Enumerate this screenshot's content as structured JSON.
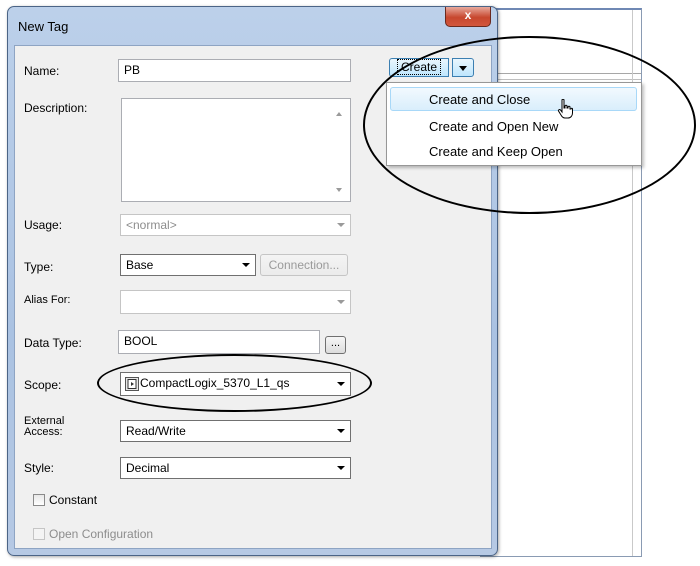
{
  "dialog": {
    "title": "New Tag",
    "close_label": "x"
  },
  "form": {
    "name_label": "Name:",
    "name_value": "PB",
    "description_label": "Description:",
    "description_value": "",
    "usage_label": "Usage:",
    "usage_value": "<normal>",
    "type_label": "Type:",
    "type_value": "Base",
    "connection_label": "Connection...",
    "alias_label": "Alias For:",
    "alias_value": "",
    "datatype_label": "Data Type:",
    "datatype_value": "BOOL",
    "browse_label": "...",
    "scope_label": "Scope:",
    "scope_value": "CompactLogix_5370_L1_qs",
    "external_label_line1": "External",
    "external_label_line2": "Access:",
    "external_value": "Read/Write",
    "style_label": "Style:",
    "style_value": "Decimal",
    "constant_label": "Constant",
    "open_config_label": "Open Configuration"
  },
  "create_button": {
    "label": "Create"
  },
  "create_menu": {
    "items": [
      {
        "label": "Create and Close",
        "highlighted": true
      },
      {
        "label": "Create and Open New",
        "highlighted": false
      },
      {
        "label": "Create and Keep Open",
        "highlighted": false
      }
    ]
  }
}
